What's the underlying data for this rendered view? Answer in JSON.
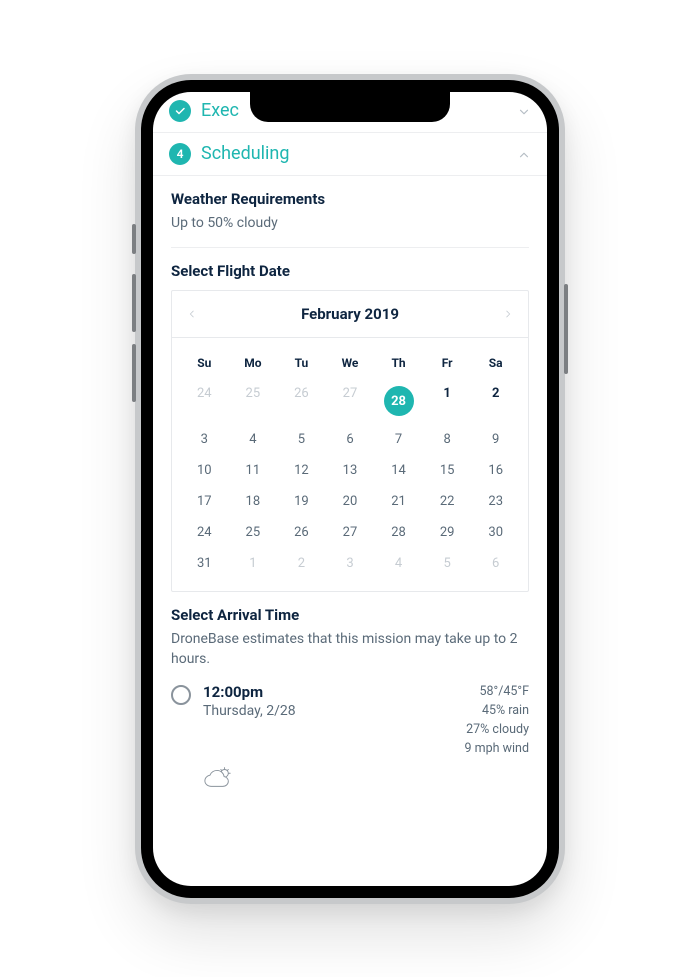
{
  "colors": {
    "accent": "#1fb6b0",
    "text_dark": "#0e2540",
    "text_mid": "#5a6a78",
    "text_light": "#c6ccd2"
  },
  "steps": {
    "prev": {
      "label": "Exec"
    },
    "current": {
      "number": "4",
      "label": "Scheduling"
    }
  },
  "weather_req": {
    "title": "Weather Requirements",
    "value": "Up to 50% cloudy"
  },
  "flight_date": {
    "title": "Select Flight Date"
  },
  "calendar": {
    "month_label": "February 2019",
    "dow": [
      "Su",
      "Mo",
      "Tu",
      "We",
      "Th",
      "Fr",
      "Sa"
    ],
    "selected": 28,
    "rows": [
      [
        {
          "n": 24,
          "out": true
        },
        {
          "n": 25,
          "out": true
        },
        {
          "n": 26,
          "out": true
        },
        {
          "n": 27,
          "out": true
        },
        {
          "n": 28,
          "sel": true
        },
        {
          "n": 1,
          "bold": true
        },
        {
          "n": 2,
          "bold": true
        }
      ],
      [
        {
          "n": 3
        },
        {
          "n": 4
        },
        {
          "n": 5
        },
        {
          "n": 6
        },
        {
          "n": 7
        },
        {
          "n": 8
        },
        {
          "n": 9
        }
      ],
      [
        {
          "n": 10
        },
        {
          "n": 11
        },
        {
          "n": 12
        },
        {
          "n": 13
        },
        {
          "n": 14
        },
        {
          "n": 15
        },
        {
          "n": 16
        }
      ],
      [
        {
          "n": 17
        },
        {
          "n": 18
        },
        {
          "n": 19
        },
        {
          "n": 20
        },
        {
          "n": 21
        },
        {
          "n": 22
        },
        {
          "n": 23
        }
      ],
      [
        {
          "n": 24
        },
        {
          "n": 25
        },
        {
          "n": 26
        },
        {
          "n": 27
        },
        {
          "n": 28
        },
        {
          "n": 29
        },
        {
          "n": 30
        }
      ],
      [
        {
          "n": 31
        },
        {
          "n": 1,
          "out": true
        },
        {
          "n": 2,
          "out": true
        },
        {
          "n": 3,
          "out": true
        },
        {
          "n": 4,
          "out": true
        },
        {
          "n": 5,
          "out": true
        },
        {
          "n": 6,
          "out": true
        }
      ]
    ]
  },
  "arrival": {
    "title": "Select Arrival Time",
    "subtitle": "DroneBase estimates that this mission may take up to 2 hours.",
    "option": {
      "time": "12:00pm",
      "date": "Thursday, 2/28",
      "temp": "58°/45°F",
      "rain": "45% rain",
      "cloud": "27% cloudy",
      "wind": "9 mph wind"
    }
  }
}
